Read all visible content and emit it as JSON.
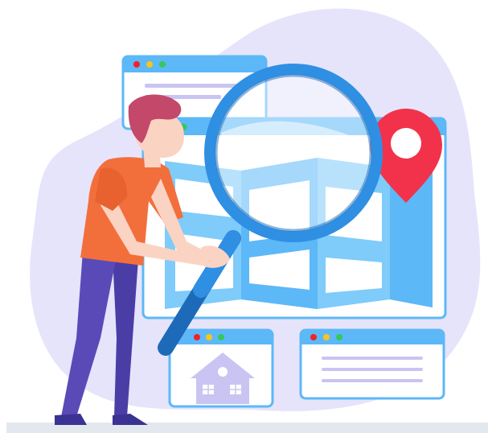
{
  "colors": {
    "background": "#ffffff",
    "blob": "#e6e4fb",
    "window_frame": "#2f9df4",
    "window_bar": "#5cb8f7",
    "window_body": "#ffffff",
    "map_fill": "#7fcbfa",
    "map_light": "#d3ecfd",
    "text_lines": "#c9c4f2",
    "dot_red": "#f2212b",
    "dot_yellow": "#f6c61d",
    "dot_green": "#35c85a",
    "pin": "#f2324b",
    "lens_ring": "#2f8fe3",
    "handle": "#1d6bb8",
    "skin": "#fbd3c3",
    "hair": "#c3486a",
    "shirt": "#f26f3c",
    "pants": "#5a4ab8",
    "shoes": "#3a3394",
    "house": "#c9c4f2",
    "floor": "#e3e8ee"
  },
  "icons": [
    "browser-window-icon",
    "map-icon",
    "location-pin-icon",
    "magnifying-glass-icon",
    "house-icon",
    "text-lines-icon",
    "person-illustration"
  ]
}
